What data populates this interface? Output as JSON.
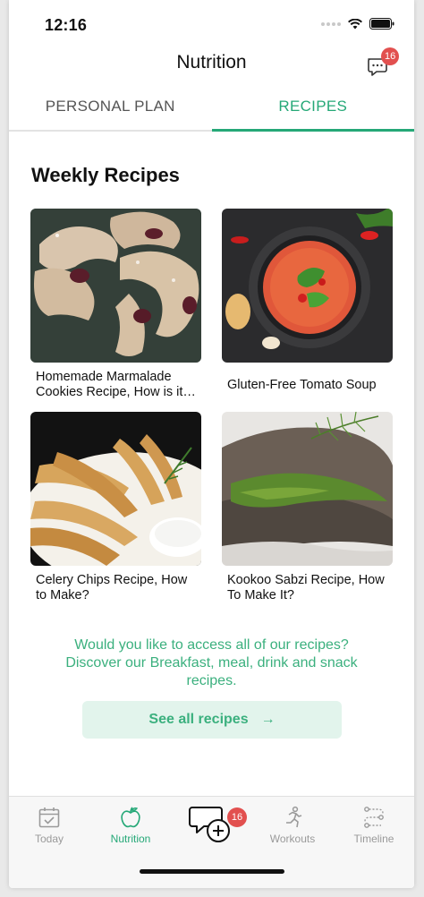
{
  "status": {
    "time": "12:16"
  },
  "header": {
    "title": "Nutrition",
    "chat_badge": "16"
  },
  "tabs": [
    {
      "label": "PERSONAL PLAN",
      "active": false
    },
    {
      "label": "RECIPES",
      "active": true
    }
  ],
  "section": {
    "title": "Weekly Recipes"
  },
  "recipes": [
    {
      "title": "Homemade Marmalade Cookies Recipe, How is it…",
      "image": "marmalade-cookies"
    },
    {
      "title": "Gluten-Free Tomato Soup",
      "image": "tomato-soup"
    },
    {
      "title": "Celery Chips Recipe, How to Make?",
      "image": "celery-chips"
    },
    {
      "title": "Kookoo Sabzi Recipe, How To Make It?",
      "image": "kookoo-sabzi"
    }
  ],
  "promo": {
    "text": "Would you like to access all of our recipes? Discover our Breakfast, meal, drink and snack recipes.",
    "button_label": "See all recipes",
    "button_arrow": "→"
  },
  "bottom_nav": {
    "items": [
      {
        "label": "Today",
        "icon": "calendar-check-icon",
        "active": false
      },
      {
        "label": "Nutrition",
        "icon": "apple-icon",
        "active": true
      },
      {
        "label": "Workouts",
        "icon": "running-person-icon",
        "active": false
      },
      {
        "label": "Timeline",
        "icon": "timeline-icon",
        "active": false
      }
    ],
    "center_badge": "16"
  },
  "colors": {
    "accent": "#25a877",
    "promo_text": "#3bb07e",
    "button_bg": "#e2f4ec",
    "badge": "#e2504f"
  }
}
